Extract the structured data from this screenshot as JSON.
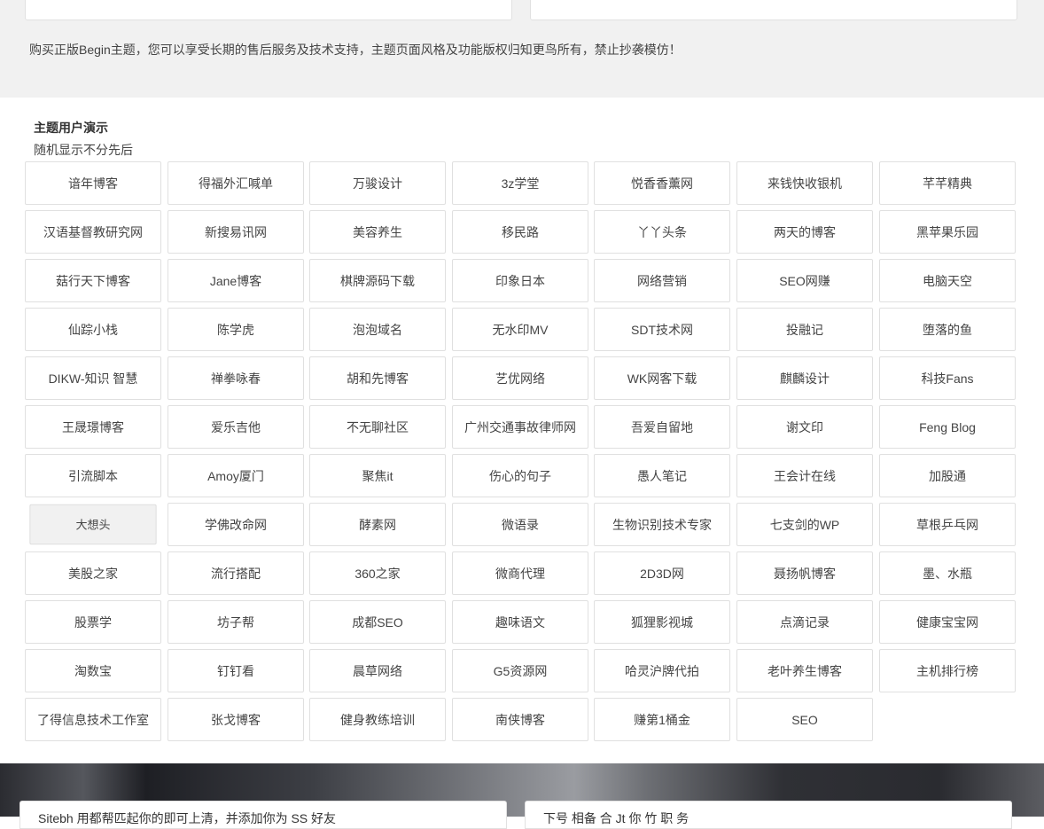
{
  "notice": "购买正版Begin主题，您可以享受长期的售后服务及技术支持，主题页面风格及功能版权归知更鸟所有，禁止抄袭模仿！",
  "section": {
    "title": "主题用户演示",
    "subtitle": "随机显示不分先后"
  },
  "sites": [
    "谙年博客",
    "得福外汇喊单",
    "万骏设计",
    "3z学堂",
    "悦香香薰网",
    "来钱快收银机",
    "芊芊精典",
    "汉语基督教研究网",
    "新搜易讯网",
    "美容养生",
    "移民路",
    "丫丫头条",
    "两天的博客",
    "黑苹果乐园",
    "菇行天下博客",
    "Jane博客",
    "棋牌源码下载",
    "印象日本",
    "网络营销",
    "SEO网赚",
    "电脑天空",
    "仙踪小栈",
    "陈学虎",
    "泡泡域名",
    "无水印MV",
    "SDT技术网",
    "投融记",
    "堕落的鱼",
    "DIKW-知识 智慧",
    "禅拳咏春",
    "胡和先博客",
    "艺优网络",
    "WK网客下载",
    "麒麟设计",
    "科技Fans",
    "王晟璟博客",
    "爱乐吉他",
    "不无聊社区",
    "广州交通事故律师网",
    "吾爱自留地",
    "谢文印",
    "Feng Blog",
    "引流脚本",
    "Amoy厦门",
    "聚焦it",
    "伤心的句子",
    "愚人笔记",
    "王会计在线",
    "加股通",
    "大想头",
    "学佛改命网",
    "酵素网",
    "微语录",
    "生物识别技术专家",
    "七支剑的WP",
    "草根乒乓网",
    "美股之家",
    "流行搭配",
    "360之家",
    "微商代理",
    "2D3D网",
    "聂扬帆博客",
    "墨、水瓶",
    "股票学",
    "坊子帮",
    "成都SEO",
    "趣味语文",
    "狐狸影视城",
    "点滴记录",
    "健康宝宝网",
    "淘数宝",
    "钉钉看",
    "晨草网络",
    "G5资源网",
    "哈灵沪牌代拍",
    "老叶养生博客",
    "主机排行榜",
    "了得信息技术工作室",
    "张戈博客",
    "健身教练培训",
    "南侠博客",
    "赚第1桶金",
    "SEO"
  ],
  "hovered_site": "大想头",
  "bottom_cards": [
    "Sitebh 用都帮匹起你的即可上清，并添加你为 SS 好友",
    "下号 相备 合 Jt 你 竹 职 务"
  ]
}
